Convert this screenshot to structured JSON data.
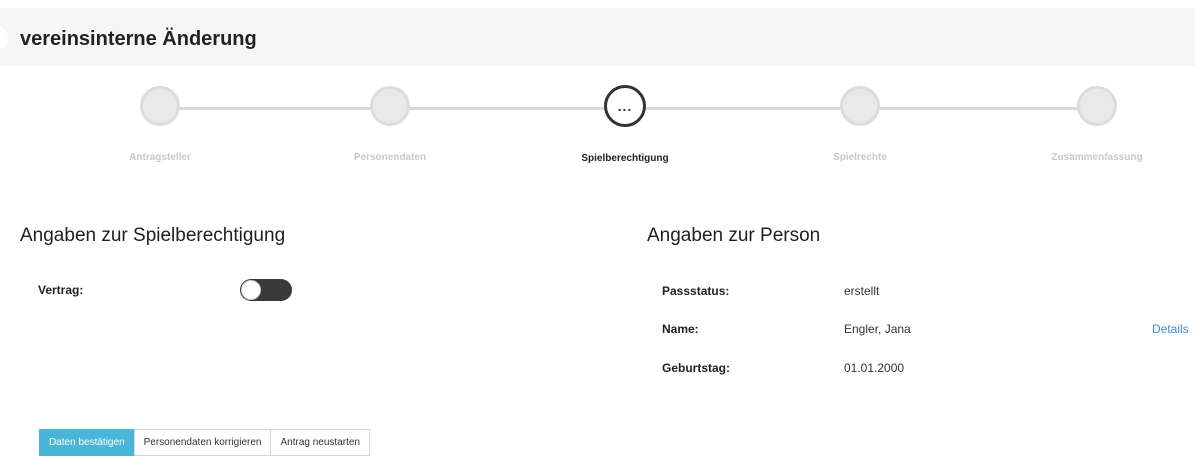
{
  "header": {
    "title": "vereinsinterne Änderung"
  },
  "stepper": {
    "steps": [
      {
        "label": "Antragsteller"
      },
      {
        "label": "Personendaten"
      },
      {
        "label": "Spielberechtigung",
        "icon": "ellipsis-icon",
        "icon_text": "..."
      },
      {
        "label": "Spielrechte"
      },
      {
        "label": "Zusammenfassung"
      }
    ],
    "active_index": 2
  },
  "left": {
    "title": "Angaben zur Spielberechtigung",
    "vertrag_label": "Vertrag:",
    "vertrag_on": false
  },
  "right": {
    "title": "Angaben zur Person",
    "passstatus_label": "Passstatus:",
    "passstatus_value": "erstellt",
    "name_label": "Name:",
    "name_value": "Engler, Jana",
    "details_link": "Details",
    "geburtstag_label": "Geburtstag:",
    "geburtstag_value": "01.01.2000"
  },
  "buttons": {
    "confirm": "Daten bestätigen",
    "correct": "Personendaten korrigieren",
    "restart": "Antrag neustarten"
  },
  "colors": {
    "primary": "#49b5d9",
    "link": "#3a8fd0",
    "toggle_track": "#3a3a3a"
  }
}
